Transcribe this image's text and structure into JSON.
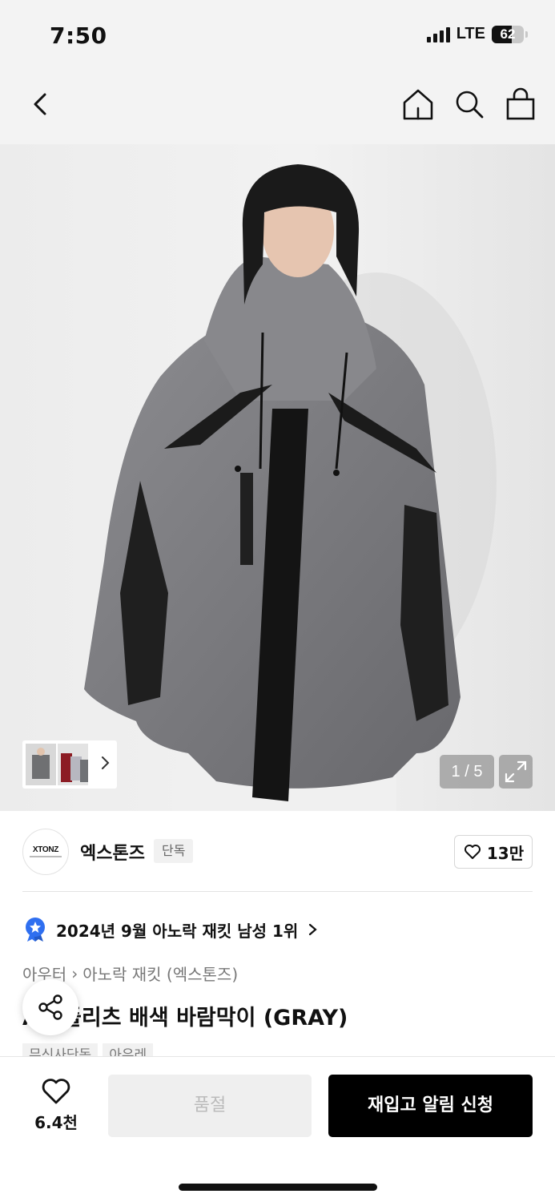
{
  "status_bar": {
    "time": "7:50",
    "network": "LTE",
    "battery": "62",
    "battery_level": 0.62
  },
  "nav": {
    "back_icon": "chevron-left-icon",
    "home_icon": "home-icon",
    "search_icon": "search-icon",
    "cart_icon": "shopping-bag-icon"
  },
  "gallery": {
    "counter": "1 / 5",
    "expand_icon": "expand-icon",
    "thumb_chevron_icon": "chevron-right-icon"
  },
  "brand": {
    "name": "엑스톤즈",
    "badge": "단독",
    "logo_text": "XTONZ",
    "likes": "13만"
  },
  "ranking": {
    "text": "2024년 9월 아노락 재킷 남성 1위"
  },
  "breadcrumb": {
    "level1": "아우터",
    "separator": "›",
    "level2": "아노락 재킷 (엑스톤즈)"
  },
  "product": {
    "title": "A3 플리츠 배색 바람막이 (GRAY)"
  },
  "tags": [
    "무신사단독",
    "아우레"
  ],
  "bottom": {
    "wish_count": "6.4천",
    "soldout_label": "품절",
    "restock_label": "재입고 알림 신청"
  },
  "colors": {
    "accent": "#000000",
    "medal": "#2f6ff0",
    "soldout_bg": "#efefef"
  }
}
